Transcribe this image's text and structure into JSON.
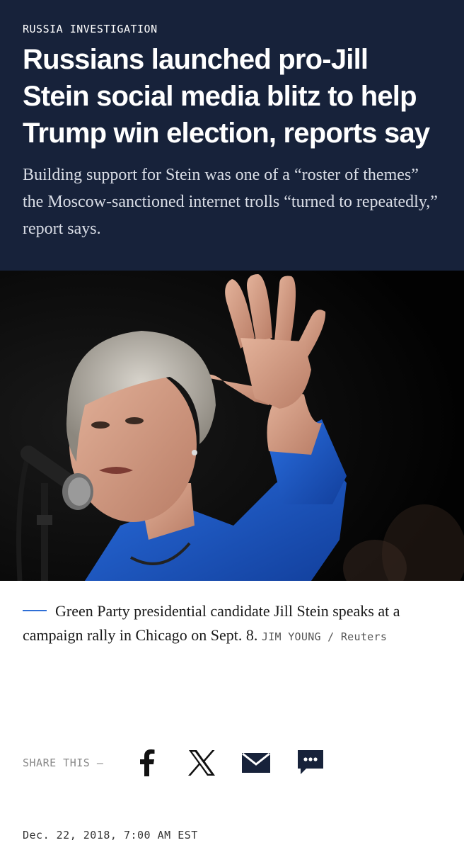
{
  "article": {
    "kicker": "RUSSIA INVESTIGATION",
    "headline": "Russians launched pro-Jill Stein social media blitz to help Trump win election, reports say",
    "dek": "Building support for Stein was one of a “roster of themes” the Moscow-sanctioned internet trolls “turned to repeatedly,” report says."
  },
  "photo": {
    "caption": "Green Party presidential candidate Jill Stein speaks at a campaign rally in Chicago on Sept. 8.",
    "credit": "JIM YOUNG / Reuters"
  },
  "share": {
    "label": "SHARE THIS —",
    "icons": [
      "facebook-icon",
      "x-icon",
      "email-icon",
      "comments-icon"
    ]
  },
  "dateline": "Dec. 22, 2018, 7:00 AM EST",
  "colors": {
    "hero_bg": "#17223a",
    "caption_rule": "#2f6fd6",
    "blazer": "#1f5fd0"
  }
}
